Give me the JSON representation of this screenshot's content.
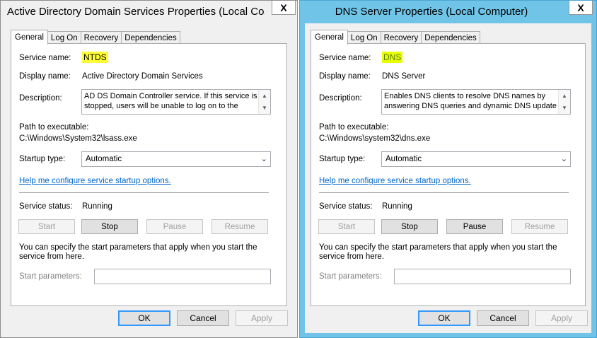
{
  "colors": {
    "highlight_left": "#ffff33",
    "highlight_right": "#e8ff00",
    "right_frame": "#6fc4e8",
    "link": "#0066cc"
  },
  "dialogs": [
    {
      "title": "Active Directory Domain Services Properties (Local Co...",
      "close_glyph": "X",
      "tabs": [
        "General",
        "Log On",
        "Recovery",
        "Dependencies"
      ],
      "labels": {
        "service_name": "Service name:",
        "display_name": "Display name:",
        "description": "Description:",
        "path": "Path to executable:",
        "startup_type": "Startup type:",
        "service_status": "Service status:",
        "start_parameters": "Start parameters:"
      },
      "service_name": "NTDS",
      "display_name": "Active Directory Domain Services",
      "description": "AD DS Domain Controller service. If this service is stopped, users will be unable to log on to the",
      "path": "C:\\Windows\\System32\\lsass.exe",
      "startup_type": "Automatic",
      "help_link": "Help me configure service startup options.",
      "service_status": "Running",
      "buttons": {
        "start": "Start",
        "stop": "Stop",
        "pause": "Pause",
        "resume": "Resume"
      },
      "pause_enabled": false,
      "info_text": "You can specify the start parameters that apply when you start the service from here.",
      "start_parameters_value": "",
      "footer": {
        "ok": "OK",
        "cancel": "Cancel",
        "apply": "Apply"
      }
    },
    {
      "title": "DNS Server Properties (Local Computer)",
      "close_glyph": "X",
      "tabs": [
        "General",
        "Log On",
        "Recovery",
        "Dependencies"
      ],
      "labels": {
        "service_name": "Service name:",
        "display_name": "Display name:",
        "description": "Description:",
        "path": "Path to executable:",
        "startup_type": "Startup type:",
        "service_status": "Service status:",
        "start_parameters": "Start parameters:"
      },
      "service_name": "DNS",
      "display_name": "DNS Server",
      "description": "Enables DNS clients to resolve DNS names by answering DNS queries and dynamic DNS update",
      "path": "C:\\Windows\\system32\\dns.exe",
      "startup_type": "Automatic",
      "help_link": "Help me configure service startup options.",
      "service_status": "Running",
      "buttons": {
        "start": "Start",
        "stop": "Stop",
        "pause": "Pause",
        "resume": "Resume"
      },
      "pause_enabled": true,
      "info_text": "You can specify the start parameters that apply when you start the service from here.",
      "start_parameters_value": "",
      "footer": {
        "ok": "OK",
        "cancel": "Cancel",
        "apply": "Apply"
      }
    }
  ]
}
